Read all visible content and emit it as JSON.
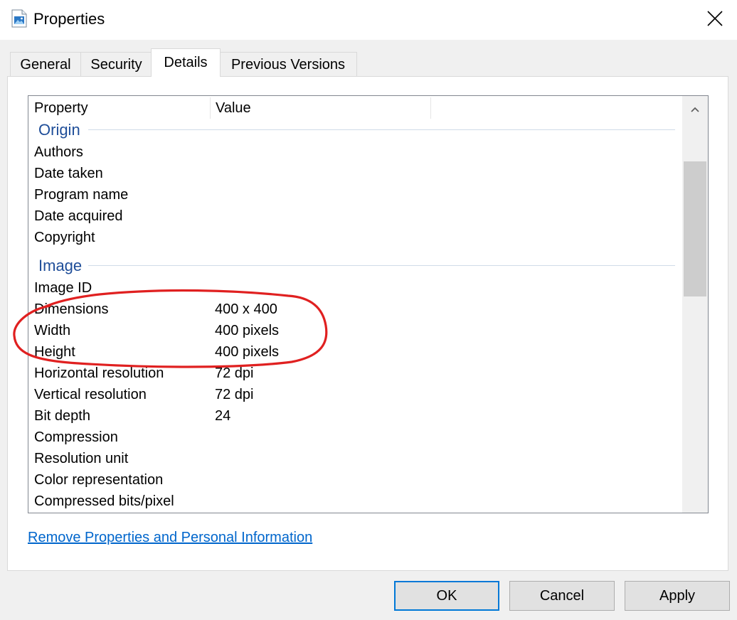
{
  "window": {
    "title": "Properties",
    "icon": "image-file-icon",
    "close_icon": "close-icon"
  },
  "tabs": [
    {
      "label": "General",
      "active": false
    },
    {
      "label": "Security",
      "active": false
    },
    {
      "label": "Details",
      "active": true
    },
    {
      "label": "Previous Versions",
      "active": false
    }
  ],
  "listview": {
    "columns": [
      "Property",
      "Value"
    ],
    "groups": [
      {
        "name": "Origin",
        "rows": [
          {
            "label": "Authors",
            "value": ""
          },
          {
            "label": "Date taken",
            "value": ""
          },
          {
            "label": "Program name",
            "value": ""
          },
          {
            "label": "Date acquired",
            "value": ""
          },
          {
            "label": "Copyright",
            "value": ""
          }
        ]
      },
      {
        "name": "Image",
        "rows": [
          {
            "label": "Image ID",
            "value": ""
          },
          {
            "label": "Dimensions",
            "value": "400 x 400"
          },
          {
            "label": "Width",
            "value": "400 pixels"
          },
          {
            "label": "Height",
            "value": "400 pixels"
          },
          {
            "label": "Horizontal resolution",
            "value": "72 dpi"
          },
          {
            "label": "Vertical resolution",
            "value": "72 dpi"
          },
          {
            "label": "Bit depth",
            "value": "24"
          },
          {
            "label": "Compression",
            "value": ""
          },
          {
            "label": "Resolution unit",
            "value": ""
          },
          {
            "label": "Color representation",
            "value": ""
          },
          {
            "label": "Compressed bits/pixel",
            "value": ""
          }
        ]
      }
    ],
    "scroll_up_icon": "chevron-up-icon"
  },
  "annotation": {
    "type": "red-ellipse-highlight",
    "color": "#e02020"
  },
  "link": {
    "label": "Remove Properties and Personal Information"
  },
  "buttons": {
    "ok": "OK",
    "cancel": "Cancel",
    "apply": "Apply"
  },
  "colors": {
    "link": "#0066cc",
    "group_header": "#1f4e99",
    "default_button_border": "#0078d7"
  }
}
